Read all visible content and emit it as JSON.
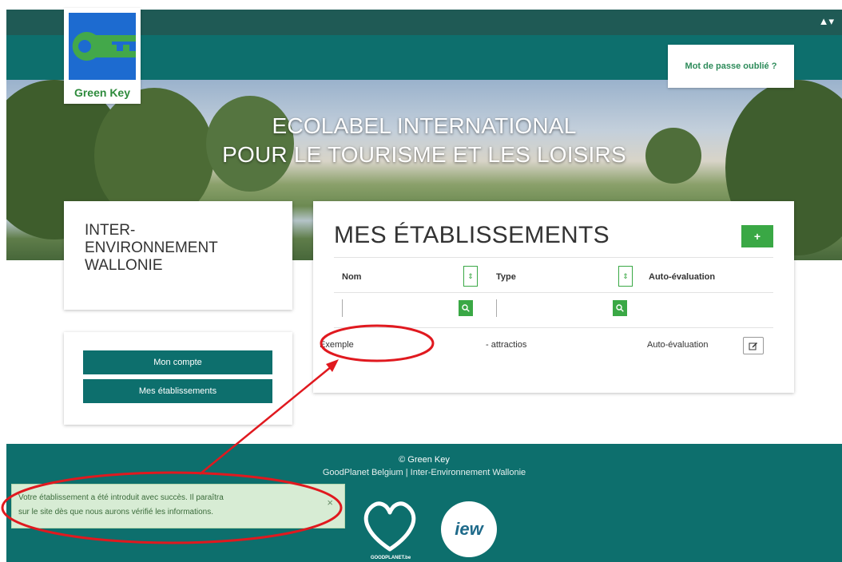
{
  "brand": {
    "logo_text": "Green Key"
  },
  "header": {
    "user_menu": "▲▾",
    "forgot_password": "Mot de passe oublié ?",
    "hero_line1": "ECOLABEL INTERNATIONAL",
    "hero_line2": "POUR LE TOURISME ET LES LOISIRS"
  },
  "sidebar": {
    "org_lines": [
      "INTER-",
      "ENVIRONNEMENT",
      "WALLONIE"
    ],
    "buttons": [
      "Mon compte",
      "Mes établissements"
    ]
  },
  "main": {
    "title": "MES ÉTABLISSEMENTS",
    "add_label": "+",
    "columns": [
      "Nom",
      "Type",
      "Auto-évaluation"
    ],
    "rows": [
      {
        "nom": "Exemple",
        "type": "- attractios",
        "auto": "Auto-évaluation"
      }
    ]
  },
  "footer": {
    "copyright": "© Green Key",
    "links": "GoodPlanet Belgium | Inter-Environnement Wallonie",
    "goodplanet_text": "GOODPLANET.be",
    "iew_text": "iew"
  },
  "toast": {
    "line1": "Votre établissement a été introduit avec succès. Il paraîtra",
    "line2": "sur le site dès que nous aurons vérifié les informations.",
    "close": "×"
  },
  "colors": {
    "teal": "#0d6f6d",
    "dark_teal": "#1f5a55",
    "green": "#3aa845",
    "logo_blue": "#1d6bd0",
    "annotation_red": "#e0191f"
  }
}
